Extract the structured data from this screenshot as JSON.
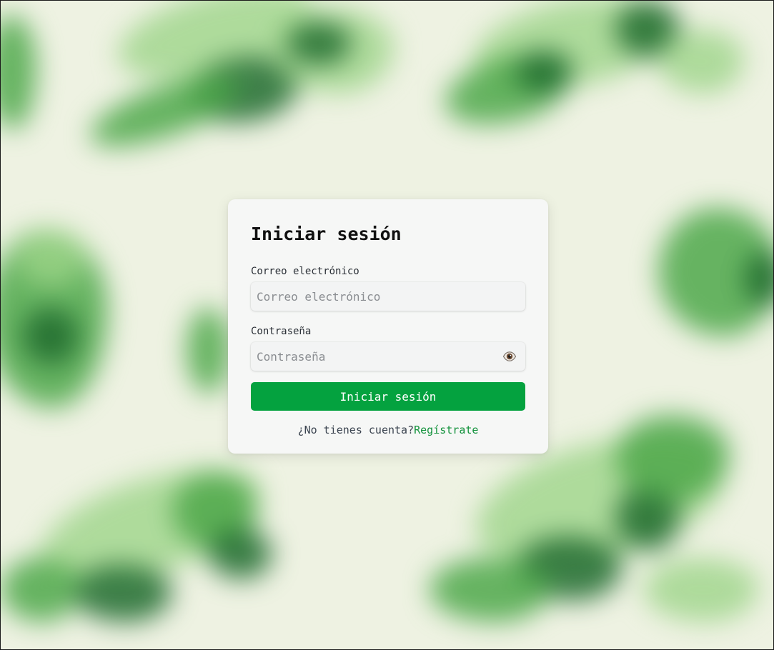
{
  "login": {
    "title": "Iniciar sesión",
    "email_label": "Correo electrónico",
    "email_placeholder": "Correo electrónico",
    "email_value": "",
    "password_label": "Contraseña",
    "password_placeholder": "Contraseña",
    "password_value": "",
    "toggle_password_icon": "eye-icon",
    "submit_label": "Iniciar sesión",
    "no_account_text": "¿No tienes cuenta?",
    "register_link": "Regístrate"
  },
  "colors": {
    "accent": "#04a23f",
    "link": "#11913a",
    "background": "#eef2e2",
    "card": "#f6f7f6"
  }
}
